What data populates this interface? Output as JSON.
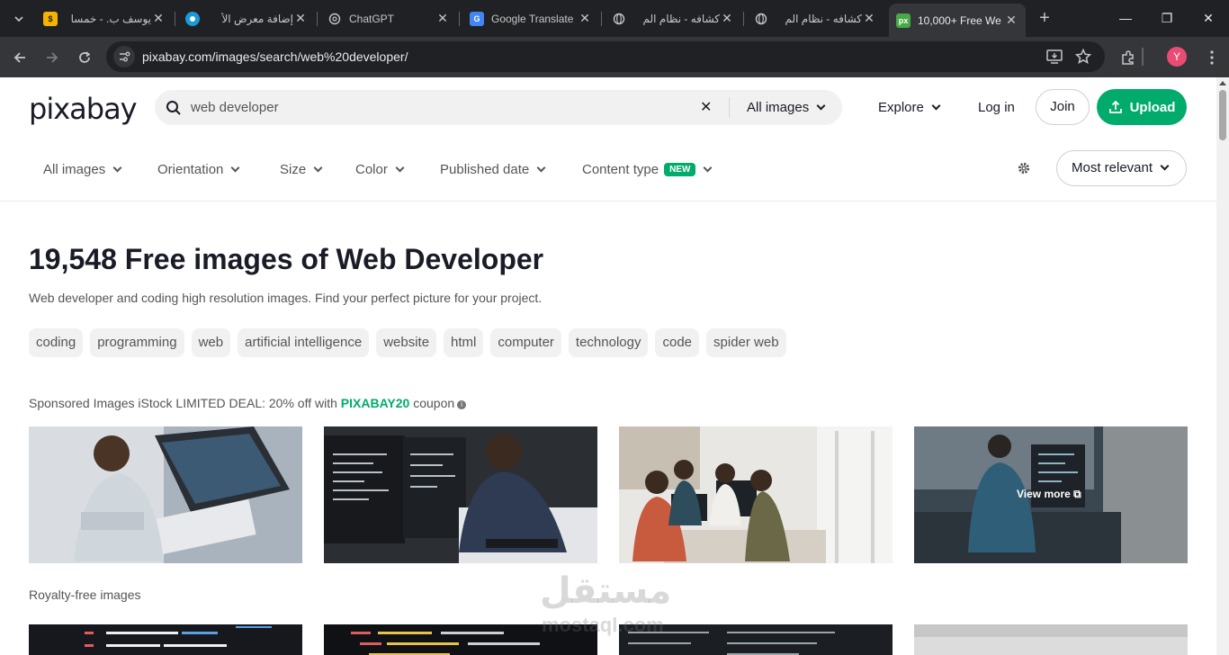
{
  "browser": {
    "tabs": [
      {
        "title": "يوسف ب. - خمسا",
        "favicon": "mostaql",
        "color": "#f5b400",
        "active": false
      },
      {
        "title": "إضافة معرض الأ",
        "favicon": "circle",
        "color": "#1a9bd7",
        "active": false
      },
      {
        "title": "ChatGPT",
        "favicon": "openai",
        "color": "#c4c7c5",
        "active": false
      },
      {
        "title": "Google Translate",
        "favicon": "translate",
        "color": "#4285f4",
        "active": false
      },
      {
        "title": "كشافه - نظام الم",
        "favicon": "globe",
        "color": "#c4c7c5",
        "active": false
      },
      {
        "title": "كشافه - نظام الم",
        "favicon": "globe",
        "color": "#c4c7c5",
        "active": false
      },
      {
        "title": "10,000+ Free We",
        "favicon": "px",
        "color": "#48a947",
        "active": true
      }
    ],
    "url": "pixabay.com/images/search/web%20developer/",
    "profile_initial": "Y"
  },
  "header": {
    "logo": "pixabay",
    "search_value": "web developer",
    "search_type": "All images",
    "explore": "Explore",
    "login": "Log in",
    "join": "Join",
    "upload": "Upload"
  },
  "filters": {
    "items": [
      "All images",
      "Orientation",
      "Size",
      "Color",
      "Published date",
      "Content type"
    ],
    "new_badge": "NEW",
    "sort": "Most relevant"
  },
  "main": {
    "title": "19,548 Free images of Web Developer",
    "subtitle": "Web developer and coding high resolution images. Find your perfect picture for your project.",
    "tags": [
      "coding",
      "programming",
      "web",
      "artificial intelligence",
      "website",
      "html",
      "computer",
      "technology",
      "code",
      "spider web"
    ],
    "sponsored_prefix": "Sponsored Images iStock LIMITED DEAL: 20% off with ",
    "sponsored_code": "PIXABAY20",
    "sponsored_suffix": " coupon",
    "view_more": "View more",
    "royalty_label": "Royalty-free images"
  },
  "watermark": {
    "line1": "مستقل",
    "line2": "mostaql.com"
  },
  "colors": {
    "accent": "#00ab6b",
    "chrome_dark": "#202124",
    "chrome_toolbar": "#35363a"
  }
}
